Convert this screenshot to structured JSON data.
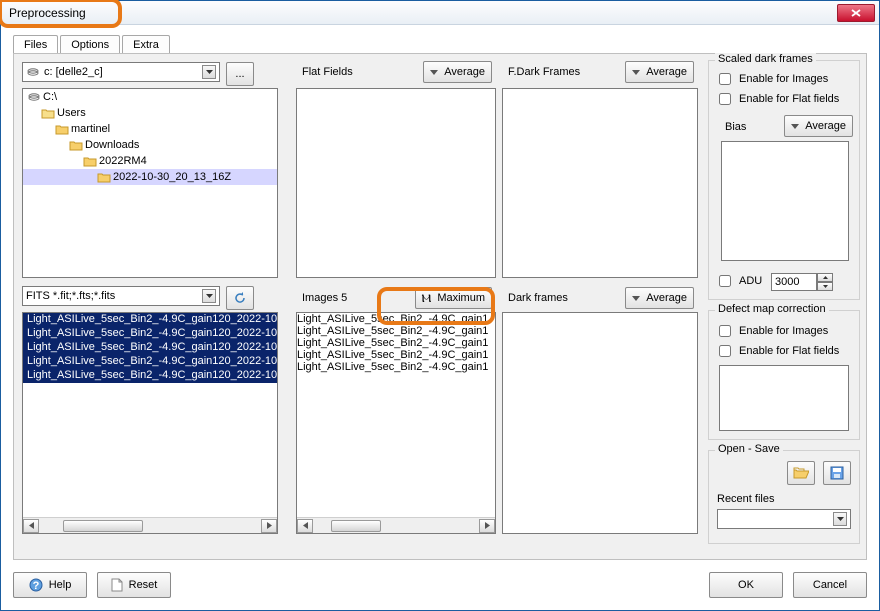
{
  "window": {
    "title": "Preprocessing"
  },
  "tabs": [
    {
      "label": "Files",
      "active": true
    },
    {
      "label": "Options",
      "active": false
    },
    {
      "label": "Extra",
      "active": false
    }
  ],
  "drives": {
    "selected": "c: [delle2_c]"
  },
  "browse_btn": "...",
  "tree": [
    {
      "depth": 0,
      "label": "C:\\",
      "kind": "drive"
    },
    {
      "depth": 1,
      "label": "Users",
      "kind": "folder"
    },
    {
      "depth": 2,
      "label": "martinel",
      "kind": "open"
    },
    {
      "depth": 3,
      "label": "Downloads",
      "kind": "open"
    },
    {
      "depth": 4,
      "label": "2022RM4",
      "kind": "open"
    },
    {
      "depth": 5,
      "label": "2022-10-30_20_13_16Z",
      "kind": "open",
      "selected": true
    }
  ],
  "filter": {
    "selected": "FITS  *.fit;*.fts;*.fits"
  },
  "files": [
    "Light_ASILive_5sec_Bin2_-4.9C_gain120_2022-10",
    "Light_ASILive_5sec_Bin2_-4.9C_gain120_2022-10",
    "Light_ASILive_5sec_Bin2_-4.9C_gain120_2022-10",
    "Light_ASILive_5sec_Bin2_-4.9C_gain120_2022-10",
    "Light_ASILive_5sec_Bin2_-4.9C_gain120_2022-10"
  ],
  "panes": {
    "flat_fields": {
      "label": "Flat Fields",
      "mode": "Average"
    },
    "f_dark_frames": {
      "label": "F.Dark Frames",
      "mode": "Average"
    },
    "images": {
      "label": "Images 5",
      "mode": "Maximum"
    },
    "dark_frames": {
      "label": "Dark frames",
      "mode": "Average"
    }
  },
  "image_list": [
    "Light_ASILive_5sec_Bin2_-4.9C_gain1",
    "Light_ASILive_5sec_Bin2_-4.9C_gain1",
    "Light_ASILive_5sec_Bin2_-4.9C_gain1",
    "Light_ASILive_5sec_Bin2_-4.9C_gain1",
    "Light_ASILive_5sec_Bin2_-4.9C_gain1"
  ],
  "scaled_dark": {
    "legend": "Scaled dark frames",
    "enable_images": "Enable for Images",
    "enable_flats": "Enable for Flat fields",
    "bias_label": "Bias",
    "bias_mode": "Average",
    "adu_label": "ADU",
    "adu_value": "3000"
  },
  "defect_map": {
    "legend": "Defect map correction",
    "enable_images": "Enable for Images",
    "enable_flats": "Enable for Flat fields"
  },
  "open_save": {
    "legend": "Open - Save",
    "recent_label": "Recent files"
  },
  "buttons": {
    "help": "Help",
    "reset": "Reset",
    "ok": "OK",
    "cancel": "Cancel"
  }
}
